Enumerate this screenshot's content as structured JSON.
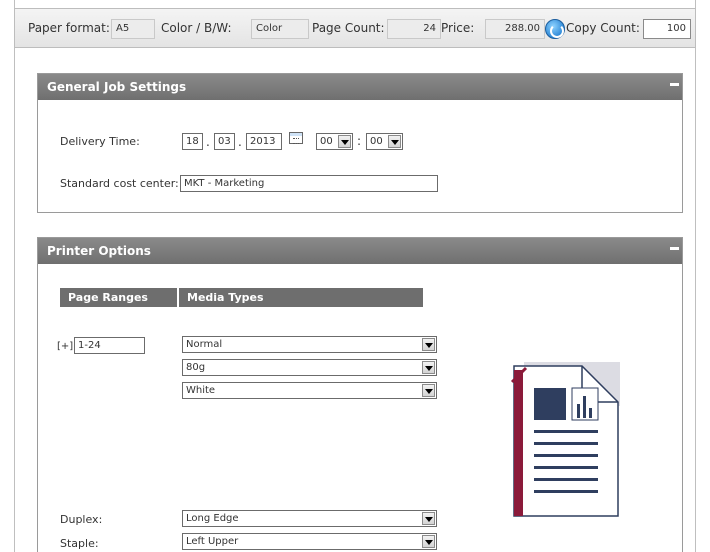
{
  "summary": {
    "paper_format_label": "Paper format:",
    "paper_format_value": "A5",
    "color_label": "Color / B/W:",
    "color_value": "Color",
    "page_count_label": "Page Count:",
    "page_count_value": "24",
    "price_label": "Price:",
    "price_value": "288.00",
    "copy_count_label": "Copy Count:",
    "copy_count_value": "100"
  },
  "general": {
    "title": "General Job Settings",
    "delivery_label": "Delivery Time:",
    "day": "18",
    "month": "03",
    "year": "2013",
    "hour": "00",
    "minute": "00",
    "dot": ".",
    "colon": ":",
    "cost_center_label": "Standard cost center:",
    "cost_center_value": "MKT - Marketing"
  },
  "printer": {
    "title": "Printer Options",
    "col_page_ranges": "Page Ranges",
    "col_media_types": "Media Types",
    "expand_label": "[+]",
    "page_range_value": "1-24",
    "media_type": "Normal",
    "media_weight": "80g",
    "media_color": "White",
    "duplex_label": "Duplex:",
    "duplex_value": "Long Edge",
    "staple_label": "Staple:",
    "staple_value": "Left Upper"
  },
  "colors": {
    "header_gray": "#777777",
    "doc_accent": "#8b1a3a",
    "doc_blue": "#2f3e5f"
  }
}
